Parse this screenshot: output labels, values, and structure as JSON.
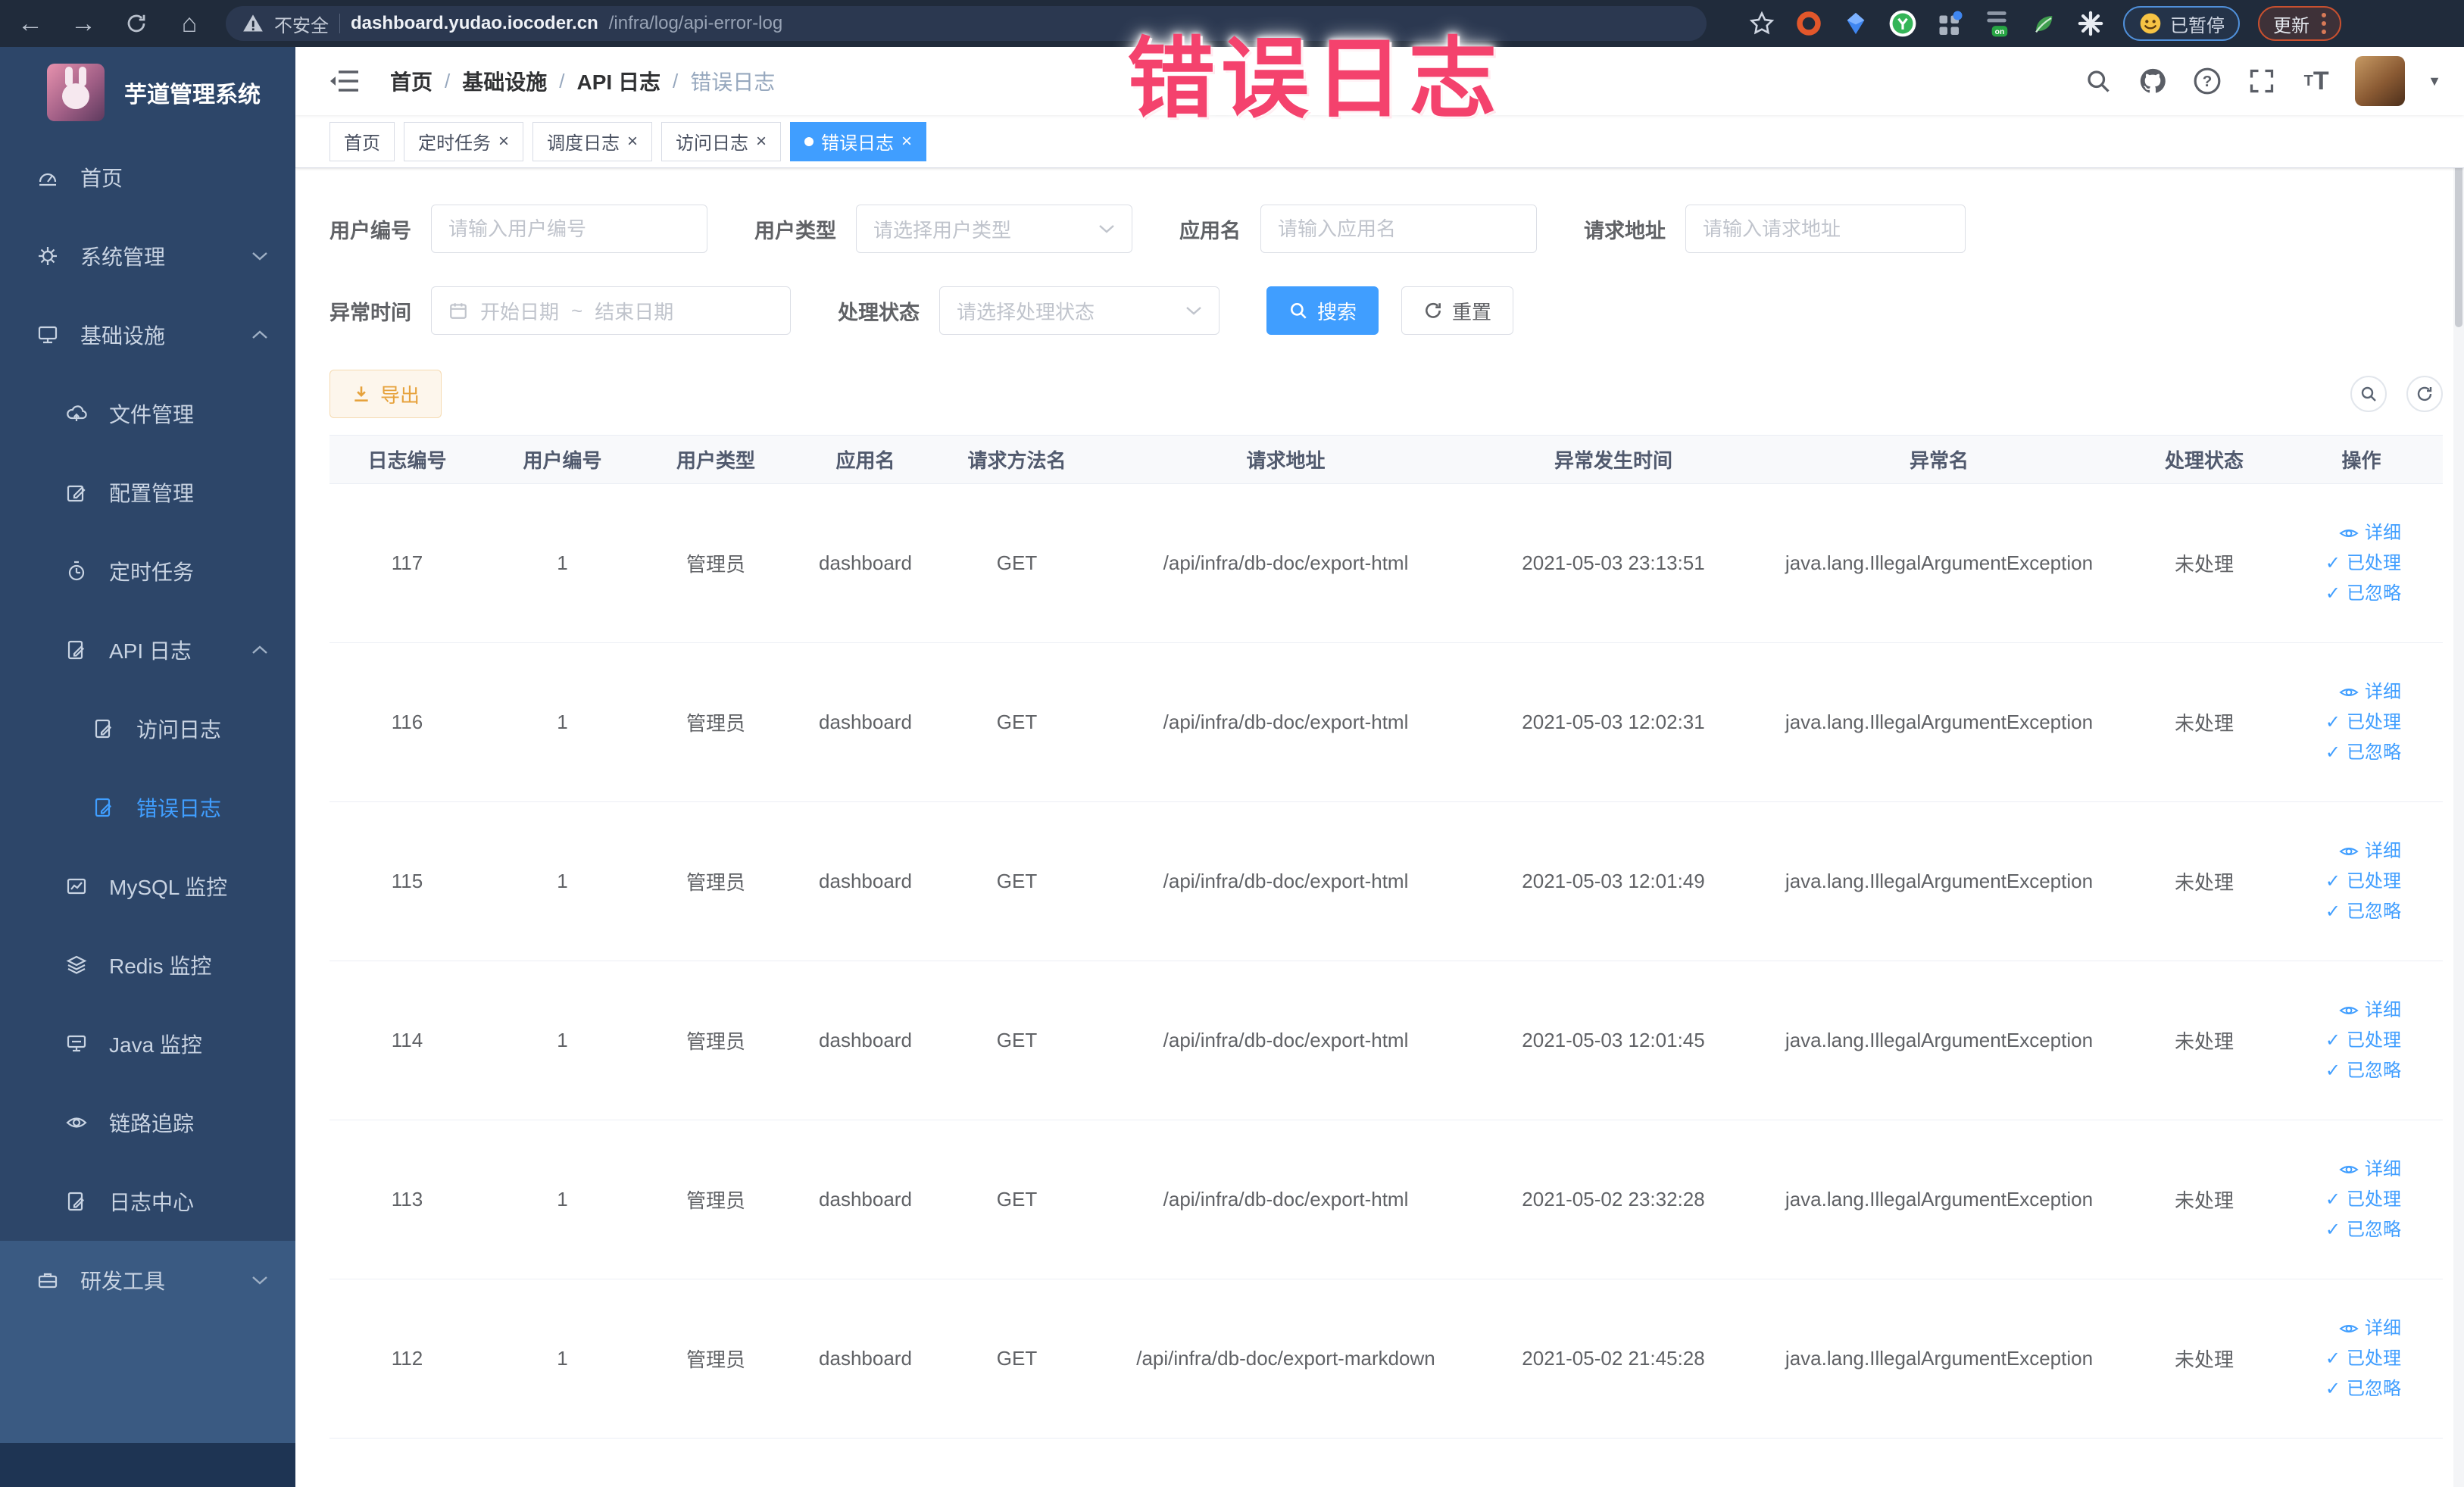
{
  "overlay": {
    "title": "错误日志"
  },
  "browser": {
    "security_label": "不安全",
    "url_host": "dashboard.yudao.iocoder.cn",
    "url_path": "/infra/log/api-error-log",
    "paused_label": "已暂停",
    "update_label": "更新"
  },
  "sidebar": {
    "app_title": "芋道管理系统",
    "items": [
      {
        "label": "首页",
        "icon": "dashboard-icon"
      },
      {
        "label": "系统管理",
        "icon": "gear-icon",
        "arrow": "down"
      },
      {
        "label": "基础设施",
        "icon": "monitor-icon",
        "arrow": "up"
      },
      {
        "label": "文件管理",
        "icon": "cloud-upload-icon"
      },
      {
        "label": "配置管理",
        "icon": "edit-icon"
      },
      {
        "label": "定时任务",
        "icon": "timer-icon"
      },
      {
        "label": "API 日志",
        "icon": "log-icon",
        "arrow": "up"
      },
      {
        "label": "访问日志",
        "icon": "log-icon"
      },
      {
        "label": "错误日志",
        "icon": "log-icon",
        "active": true
      },
      {
        "label": "MySQL 监控",
        "icon": "chart-icon"
      },
      {
        "label": "Redis 监控",
        "icon": "layers-icon"
      },
      {
        "label": "Java 监控",
        "icon": "display-icon"
      },
      {
        "label": "链路追踪",
        "icon": "eye-icon"
      },
      {
        "label": "日志中心",
        "icon": "log-icon"
      },
      {
        "label": "研发工具",
        "icon": "toolbox-icon",
        "arrow": "down"
      }
    ]
  },
  "header": {
    "breadcrumb": [
      "首页",
      "基础设施",
      "API 日志",
      "错误日志"
    ]
  },
  "tabs": [
    {
      "label": "首页"
    },
    {
      "label": "定时任务"
    },
    {
      "label": "调度日志"
    },
    {
      "label": "访问日志"
    },
    {
      "label": "错误日志"
    }
  ],
  "filters": {
    "user_id": {
      "label": "用户编号",
      "placeholder": "请输入用户编号"
    },
    "user_type": {
      "label": "用户类型",
      "placeholder": "请选择用户类型"
    },
    "app_name": {
      "label": "应用名",
      "placeholder": "请输入应用名"
    },
    "request_url": {
      "label": "请求地址",
      "placeholder": "请输入请求地址"
    },
    "exception_time": {
      "label": "异常时间",
      "start_placeholder": "开始日期",
      "separator": "~",
      "end_placeholder": "结束日期"
    },
    "process_status": {
      "label": "处理状态",
      "placeholder": "请选择处理状态"
    },
    "search_label": "搜索",
    "reset_label": "重置"
  },
  "toolbar": {
    "export_label": "导出"
  },
  "table": {
    "columns": [
      "日志编号",
      "用户编号",
      "用户类型",
      "应用名",
      "请求方法名",
      "请求地址",
      "异常发生时间",
      "异常名",
      "处理状态",
      "操作"
    ],
    "row_actions": {
      "detail": "详细",
      "done": "已处理",
      "ignore": "已忽略"
    },
    "rows": [
      {
        "id": "117",
        "user_id": "1",
        "user_type": "管理员",
        "app_name": "dashboard",
        "method": "GET",
        "url": "/api/infra/db-doc/export-html",
        "time": "2021-05-03 23:13:51",
        "exception": "java.lang.IllegalArgumentException",
        "status": "未处理"
      },
      {
        "id": "116",
        "user_id": "1",
        "user_type": "管理员",
        "app_name": "dashboard",
        "method": "GET",
        "url": "/api/infra/db-doc/export-html",
        "time": "2021-05-03 12:02:31",
        "exception": "java.lang.IllegalArgumentException",
        "status": "未处理"
      },
      {
        "id": "115",
        "user_id": "1",
        "user_type": "管理员",
        "app_name": "dashboard",
        "method": "GET",
        "url": "/api/infra/db-doc/export-html",
        "time": "2021-05-03 12:01:49",
        "exception": "java.lang.IllegalArgumentException",
        "status": "未处理"
      },
      {
        "id": "114",
        "user_id": "1",
        "user_type": "管理员",
        "app_name": "dashboard",
        "method": "GET",
        "url": "/api/infra/db-doc/export-html",
        "time": "2021-05-03 12:01:45",
        "exception": "java.lang.IllegalArgumentException",
        "status": "未处理"
      },
      {
        "id": "113",
        "user_id": "1",
        "user_type": "管理员",
        "app_name": "dashboard",
        "method": "GET",
        "url": "/api/infra/db-doc/export-html",
        "time": "2021-05-02 23:32:28",
        "exception": "java.lang.IllegalArgumentException",
        "status": "未处理"
      },
      {
        "id": "112",
        "user_id": "1",
        "user_type": "管理员",
        "app_name": "dashboard",
        "method": "GET",
        "url": "/api/infra/db-doc/export-markdown",
        "time": "2021-05-02 21:45:28",
        "exception": "java.lang.IllegalArgumentException",
        "status": "未处理"
      }
    ]
  },
  "icons": {
    "browser": [
      "back-icon",
      "forward-icon",
      "reload-icon",
      "home-icon",
      "warning-icon",
      "bookmark-star-icon",
      "extension-icons",
      "emoji-face-icon",
      "kebab-menu-icon"
    ],
    "navbar": [
      "hamburger-icon",
      "search-icon",
      "github-icon",
      "help-icon",
      "fullscreen-icon",
      "font-size-icon",
      "avatar",
      "caret-down-icon"
    ],
    "content": [
      "calendar-icon",
      "chevron-down-icon",
      "download-icon",
      "search-toggle-icon",
      "refresh-icon",
      "eye-icon",
      "check-icon"
    ]
  },
  "colors": {
    "accent": "#409eff",
    "warning": "#e6a23c",
    "sidebar_bg": "#2d4669",
    "overlay_pink": "#f4426d",
    "chrome_bg": "#202b3b"
  }
}
